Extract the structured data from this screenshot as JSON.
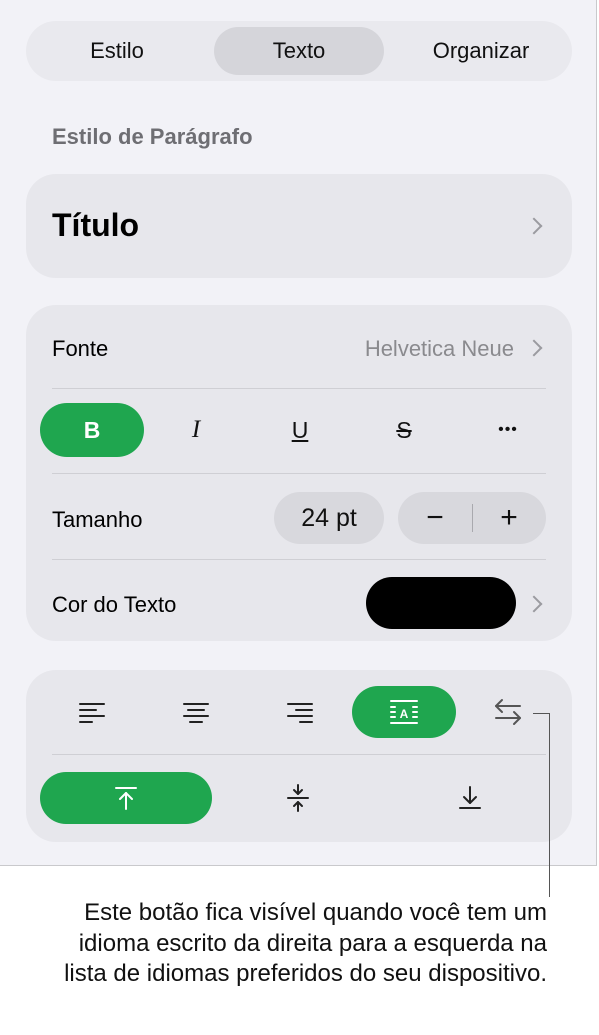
{
  "tabs": {
    "style": "Estilo",
    "text": "Texto",
    "arrange": "Organizar",
    "selected": "Texto"
  },
  "paragraph_style": {
    "section_label": "Estilo de Parágrafo",
    "value": "Título"
  },
  "font": {
    "label": "Fonte",
    "value": "Helvetica Neue"
  },
  "font_styles": {
    "bold": "B",
    "italic": "I",
    "underline": "U",
    "strikethrough": "S",
    "more": "•••"
  },
  "size": {
    "label": "Tamanho",
    "value": "24 pt",
    "decrement": "−",
    "increment": "+"
  },
  "text_color": {
    "label": "Cor do Texto",
    "color": "#000000"
  },
  "alignment": {
    "horizontal": [
      "align-left",
      "align-center",
      "align-right",
      "justify",
      "text-direction"
    ],
    "horizontal_selected": "justify",
    "vertical": [
      "align-top",
      "align-middle",
      "align-bottom"
    ],
    "vertical_selected": "align-top"
  },
  "callout": "Este botão fica visível quando você tem um idioma escrito da direita para a esquerda na lista de idiomas preferidos do seu dispositivo.",
  "colors": {
    "accent": "#1fa64f",
    "panel": "#f2f2f7",
    "card": "#e7e7ec"
  }
}
